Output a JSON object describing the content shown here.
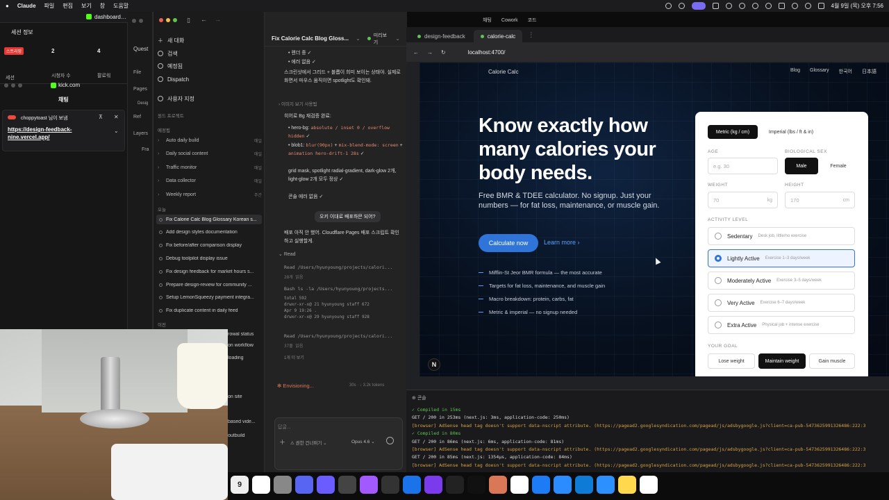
{
  "menubar": {
    "app": "Claude",
    "items": [
      "파일",
      "편집",
      "보기",
      "창",
      "도움말"
    ],
    "clock": "4월 9일 (목) 오후 7:56"
  },
  "left_strip": {
    "tab1": "dashboard.kic",
    "session_title": "세션 정보",
    "stats": [
      {
        "label": "세션",
        "value": "스트리밍"
      },
      {
        "label": "시청자 수",
        "value": "2"
      },
      {
        "label": "팔로워",
        "value": "4"
      }
    ],
    "kick_title": "kick.com",
    "chat_label": "채팅",
    "pinned_user": "choppytoast 님이 보냄",
    "pinned_link": "https://design-feedback-nine.vercel.app/"
  },
  "mid_strip": {
    "items": [
      "Quest",
      "File",
      "Pages",
      "Desig",
      "Ref",
      "Layers",
      "Fra"
    ]
  },
  "claude": {
    "nav": [
      "새 대화",
      "검색",
      "예정됨",
      "Dispatch",
      "사용자 지정"
    ],
    "projects_label": "원드 프로젝트",
    "scheduled_label": "예정됨",
    "projects": [
      {
        "name": "Auto daily build",
        "tag": "매일"
      },
      {
        "name": "Daily social content",
        "tag": "매일"
      },
      {
        "name": "Traffic monitor",
        "tag": "매일"
      },
      {
        "name": "Data collector",
        "tag": "매일"
      },
      {
        "name": "Weekly report",
        "tag": "주간"
      }
    ],
    "today_label": "오늘",
    "chats": [
      "Fix Calorie Calc Blog Glossary Korean s...",
      "Add design styles documentation",
      "Fix before/after comparison display",
      "Debug toolpilot display issue",
      "Fix design feedback for market hours s...",
      "Prepare design-review for community ...",
      "Setup LemonSqueezy payment integra...",
      "Fix duplicate content in daily feed"
    ],
    "older_label": "이전",
    "older_chats": [
      "rowal status",
      "on workflow",
      "loading",
      "on site",
      "based vide...",
      "outbuild"
    ],
    "chat_title": "Fix Calorie Calc Blog Gloss...",
    "chat_badge": "미리보기",
    "lines": {
      "l1": "렌더 중 ✓",
      "l2": "에러 없음 ✓",
      "p1": "스크린샷에서 그리드 + 블롭이 희미 보이는 상태야. 실제로 화면서 마우스 움직이면 spotlight도 확인돼.",
      "collapsed": "이미지 보기 사용됨",
      "p2": "히어로 Bg 재검증 완료:",
      "b1a": "hero-bg:",
      "b1c": "absolute / inset 0 / overflow hidden",
      "b1e": "✓",
      "b2a": "blob1:",
      "b2c": "blur(90px)",
      "b2d": " + ",
      "b2e": "mix-blend-mode: screen",
      "b2f": " + ",
      "b2g": "animation hero-drift-1 28s",
      "b2h": "✓",
      "b3": "grid mask, spotlight radial-gradient, dark-glow 2개, light-glow 2개 모두 정상 ✓",
      "b4": "콘솔 에러 없음 ✓",
      "user": "오키 이대로 배포하믄 되어?",
      "p3": "배포 아직 안 했어. Cloudflare Pages 배포 스크립트 확인하고 실행할게.",
      "read_head": "Read",
      "read1": "Read /Users/hyunyoung/projects/calori...",
      "read1sub": "28개 읽음",
      "bash": "Bash ls -la /Users/hyunyoung/projects...",
      "out1": "total 592",
      "out2": "drwxr-xr-x@  21 hyunyoung  staff    672",
      "out3": "Apr  9 19:26 .",
      "out4": "drwxr-xr-x@  29 hyunyoung  staff    928",
      "read2": "Read /Users/hyunyoung/projects/calori...",
      "read2sub": "37줄 읽음",
      "more": "1개 더 보기",
      "status": "✻ Envisioning...",
      "status_meta": "30s · ↓ 3.2k tokens",
      "placeholder": "답글...",
      "permission": "권한 건너뛰기",
      "model": "Opus 4.6"
    }
  },
  "browser": {
    "top_tabs": [
      "채팅",
      "Cowork",
      "코드"
    ],
    "tabs": [
      "design-feedback",
      "calorie-calc"
    ],
    "url": "localhost:4700/"
  },
  "site": {
    "brand": "Calorie Calc",
    "links": [
      "Blog",
      "Glossary",
      "한국어",
      "日本語"
    ],
    "hero": "Know exactly how many calories your body needs.",
    "sub": "Free BMR & TDEE calculator. No signup. Just your numbers — for fat loss, maintenance, or muscle gain.",
    "cta": "Calculate now",
    "learn": "Learn more ›",
    "features": [
      "Mifflin-St Jeor BMR formula — the most accurate",
      "Targets for fat loss, maintenance, and muscle gain",
      "Macro breakdown: protein, carbs, fat",
      "Metric & imperial — no signup needed"
    ],
    "badge": "N"
  },
  "form": {
    "units": [
      "Metric (kg / cm)",
      "Imperial (lbs / ft & in)"
    ],
    "age_label": "AGE",
    "age_placeholder": "e.g. 30",
    "sex_label": "BIOLOGICAL SEX",
    "sex": [
      "Male",
      "Female"
    ],
    "weight_label": "WEIGHT",
    "weight_value": "70",
    "weight_unit": "kg",
    "height_label": "HEIGHT",
    "height_value": "170",
    "height_unit": "cm",
    "activity_label": "ACTIVITY LEVEL",
    "activities": [
      {
        "name": "Sedentary",
        "hint": "Desk job, little/no exercise"
      },
      {
        "name": "Lightly Active",
        "hint": "Exercise 1–3 days/week"
      },
      {
        "name": "Moderately Active",
        "hint": "Exercise 3–5 days/week"
      },
      {
        "name": "Very Active",
        "hint": "Exercise 6–7 days/week"
      },
      {
        "name": "Extra Active",
        "hint": "Physical job + intense exercise"
      }
    ],
    "goal_label": "YOUR GOAL",
    "goals": [
      "Lose weight",
      "Maintain weight",
      "Gain muscle"
    ]
  },
  "terminal": {
    "title": "콘솔",
    "lines": [
      "✓ Compiled in 15ms",
      " GET / 200 in 253ms (next.js: 3ms, application-code: 250ms)",
      "[browser] AdSense head tag doesn't support data-nscript attribute. (https://pagead2.googlesyndication.com/pagead/js/adsbygoogle.js?client=ca-pub-5473625991326486:222:3",
      "✓ Compiled in 80ms",
      " GET / 200 in 86ms (next.js: 6ms, application-code: 81ms)",
      "[browser] AdSense head tag doesn't support data-nscript attribute. (https://pagead2.googlesyndication.com/pagead/js/adsbygoogle.js?client=ca-pub-5473625991326486:222:3",
      " GET / 200 in 85ms (next.js: 1354µs, application-code: 84ms)",
      "[browser] AdSense head tag doesn't support data-nscript attribute. (https://pagead2.googlesyndication.com/pagead/js/adsbygoogle.js?client=ca-pub-5473625991326486:222:3"
    ]
  },
  "dock": {
    "calendar_day": "9",
    "apps": [
      "calendar-icon",
      "notion-icon",
      "calculator-icon",
      "discord-icon",
      "chat-icon",
      "chrome-icon",
      "figma-icon",
      "cube-icon",
      "app-icon",
      "obsidian-icon",
      "r-icon",
      "terminal-icon",
      "claude-icon",
      "font-icon",
      "xcode-icon",
      "finder-icon",
      "vscode-icon",
      "mail-icon",
      "notes-icon",
      "chatgpt-icon"
    ]
  },
  "colors": {
    "accent": "#2f74d9",
    "link": "#5aa1ff",
    "claude_orange": "#d97757",
    "ok": "#5fc453",
    "warn": "#d8a443"
  }
}
